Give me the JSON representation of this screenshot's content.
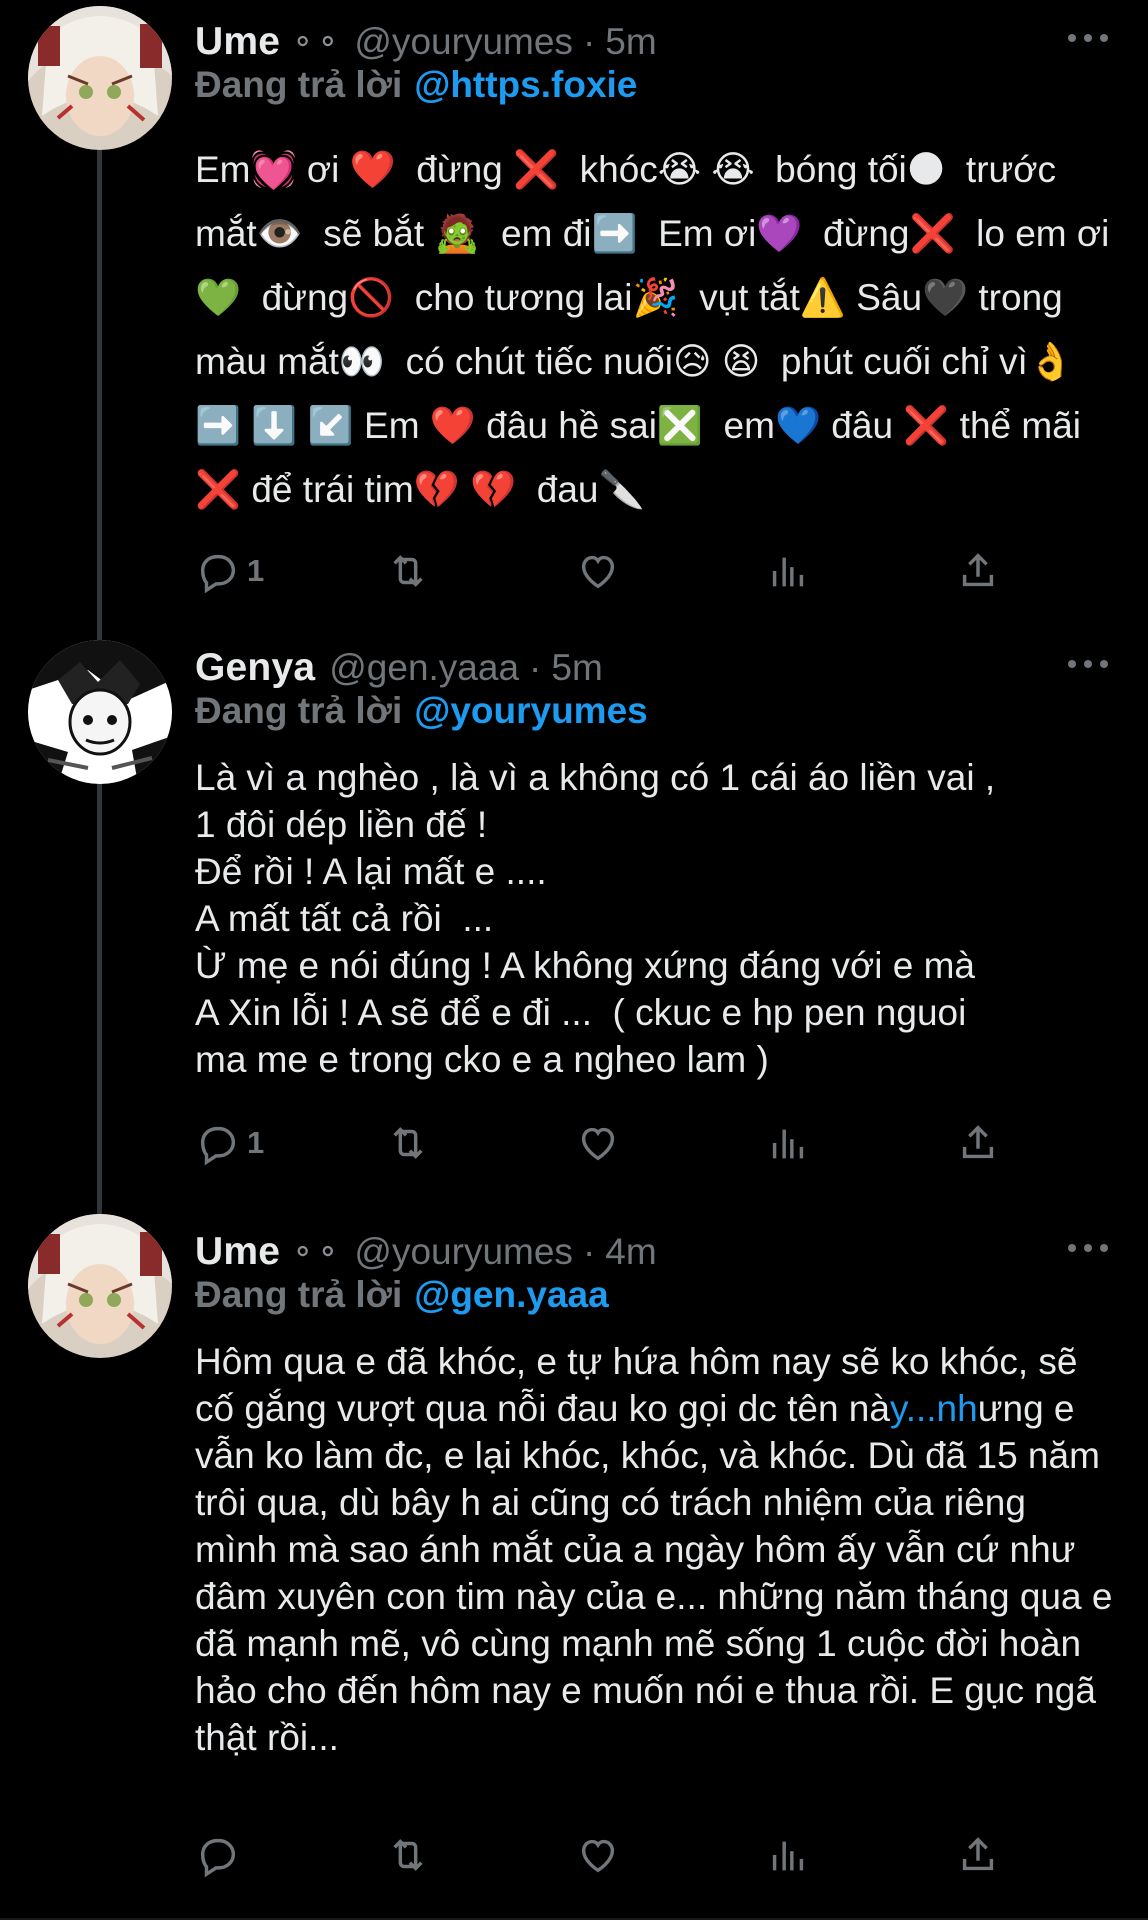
{
  "tweets": [
    {
      "name": "Ume",
      "name_emoji": "⚬⚬",
      "handle": "@youryumes",
      "separator": "·",
      "time": "5m",
      "reply_prefix": "Đang trả lời",
      "reply_to": "@https.foxie",
      "body": "Em💓 ơi ❤️  đừng ❌  khóc😭 😭  bóng tối🌑  trước mắt👁️  sẽ bắt 🧟  em đi➡️  Em ơi💜  đừng❌  lo em ơi💚  đừng🚫  cho tương lai🎉  vụt tắt⚠️ Sâu🖤 trong màu mắt👀  có chút tiếc nuối😥 😫  phút cuối chỉ vì👌 ➡️ ⬇️ ↙️ Em ❤️ đâu hề sai❎  em💙 đâu ❌ thể mãi ❌ để trái tim💔 💔  đau🔪",
      "actions": {
        "reply_count": "1",
        "retweet_count": "",
        "like_count": ""
      }
    },
    {
      "name": "Genya",
      "handle": "@gen.yaaa",
      "separator": "·",
      "time": "5m",
      "reply_prefix": "Đang trả lời",
      "reply_to": "@youryumes",
      "body": "Là vì a nghèo , là vì a không có 1 cái áo liền vai ,\n1 đôi dép liền đế !\nĐể rồi ! A lại mất e ....\nA mất tất cả rồi  ...\nỪ mẹ e nói đúng ! A không xứng đáng với e mà\nA Xin lỗi ! A sẽ để e đi ...  ( ckuc e hp pen nguoi\nma me e trong cko e a ngheo lam )",
      "actions": {
        "reply_count": "1",
        "retweet_count": "",
        "like_count": ""
      }
    },
    {
      "name": "Ume",
      "name_emoji": "⚬⚬",
      "handle": "@youryumes",
      "separator": "·",
      "time": "4m",
      "reply_prefix": "Đang trả lời",
      "reply_to": "@gen.yaaa",
      "body_before": "Hôm qua e đã khóc, e tự hứa hôm nay sẽ ko khóc, sẽ cố gắng vượt qua nỗi đau ko gọi dc tên nà",
      "body_link": "y...nh",
      "body_after": "ưng e vẫn ko làm đc, e lại khóc, khóc, và khóc. Dù đã 15 năm trôi qua, dù bây h ai cũng có trách nhiệm của riêng mình mà sao ánh mắt của a ngày hôm ấy vẫn cứ như đâm xuyên con tim này của e... những năm tháng qua e đã mạnh mẽ, vô cùng mạnh mẽ sống 1 cuộc đời hoàn hảo cho đến hôm nay e muốn nói e thua rồi. E gục ngã thật rồi...",
      "actions": {
        "reply_count": "",
        "retweet_count": "",
        "like_count": ""
      }
    }
  ],
  "colors": {
    "background": "#000000",
    "text": "#e7e9ea",
    "muted": "#71767b",
    "accent": "#1d9bf0",
    "thread_line": "#333639"
  },
  "icons": [
    "reply-icon",
    "retweet-icon",
    "like-icon",
    "views-icon",
    "share-icon",
    "more-icon"
  ]
}
